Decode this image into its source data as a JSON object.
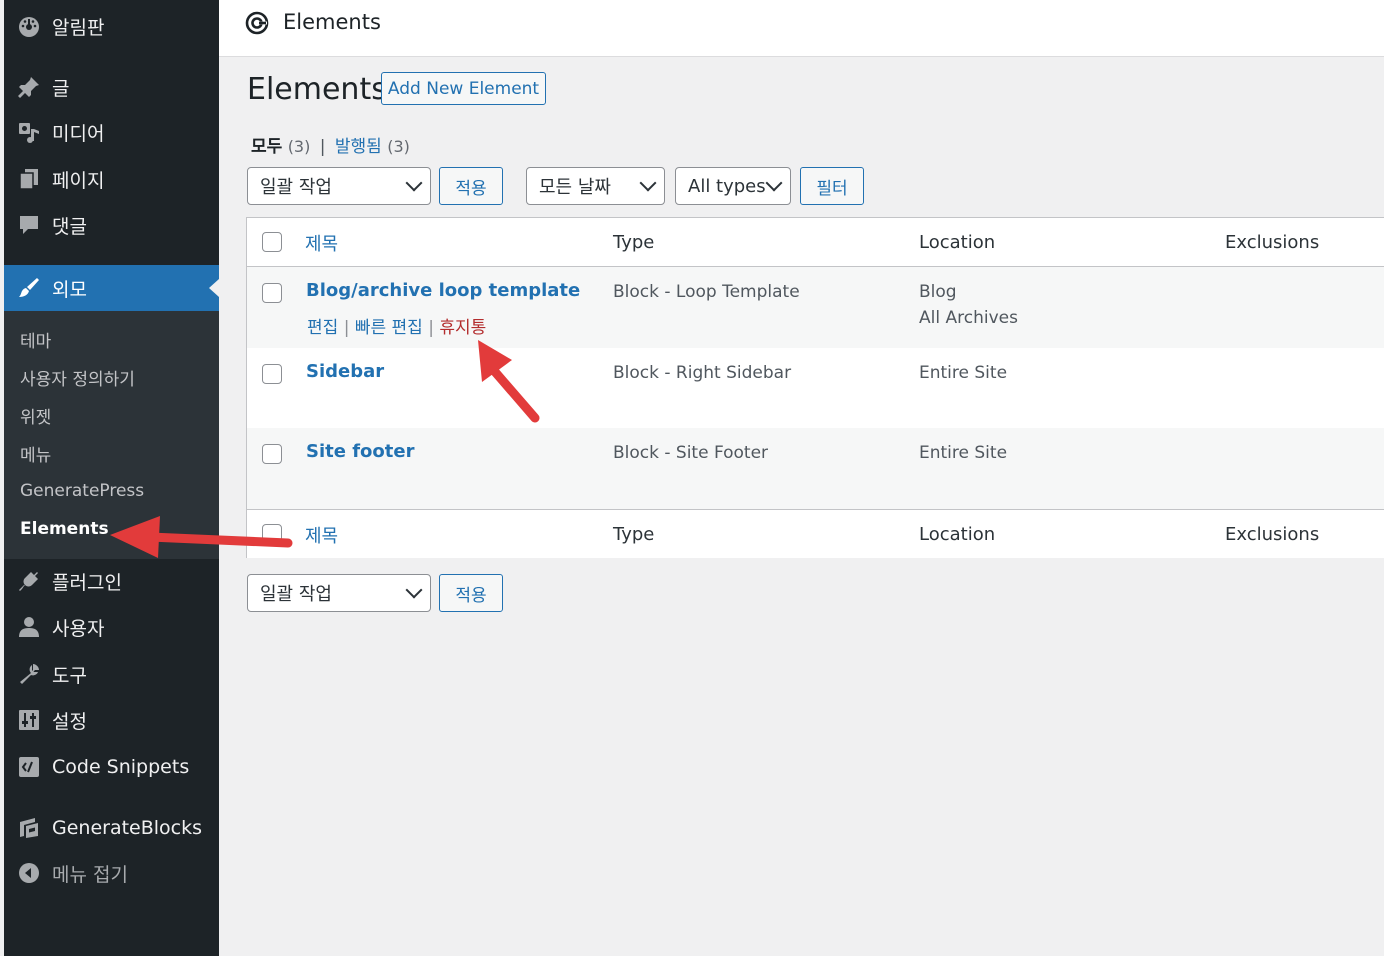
{
  "sidebar": {
    "dashboard": "알림판",
    "posts": "글",
    "media": "미디어",
    "pages": "페이지",
    "comments": "댓글",
    "appearance": "외모",
    "submenu": [
      "테마",
      "사용자 정의하기",
      "위젯",
      "메뉴",
      "GeneratePress",
      "Elements"
    ],
    "plugins": "플러그인",
    "users": "사용자",
    "tools": "도구",
    "settings": "설정",
    "code_snippets": "Code Snippets",
    "generateblocks": "GenerateBlocks",
    "collapse": "메뉴 접기"
  },
  "topbar": {
    "title": "Elements"
  },
  "main": {
    "title": "Elements",
    "add_new": "Add New Element",
    "views": {
      "all_label": "모두",
      "all_count": "(3)",
      "separator": "|",
      "published_label": "발행됨",
      "published_count": "(3)"
    },
    "bulk_action": "일괄 작업",
    "apply": "적용",
    "date_filter": "모든 날짜",
    "type_filter": "All types",
    "filter_button": "필터"
  },
  "table": {
    "columns": {
      "title": "제목",
      "type": "Type",
      "location": "Location",
      "exclusions": "Exclusions"
    },
    "rows": [
      {
        "title": "Blog/archive loop template",
        "type": "Block - Loop Template",
        "location1": "Blog",
        "location2": "All Archives",
        "actions": {
          "edit": "편집",
          "quick_edit": "빠른 편집",
          "trash": "휴지통",
          "sep": "|"
        }
      },
      {
        "title": "Sidebar",
        "type": "Block - Right Sidebar",
        "location1": "Entire Site"
      },
      {
        "title": "Site footer",
        "type": "Block - Site Footer",
        "location1": "Entire Site"
      }
    ]
  },
  "colors": {
    "sidebar_bg": "#1d2327",
    "accent": "#2271b1",
    "trash": "#b32d2e",
    "annotation_arrow": "#e23b3b"
  }
}
